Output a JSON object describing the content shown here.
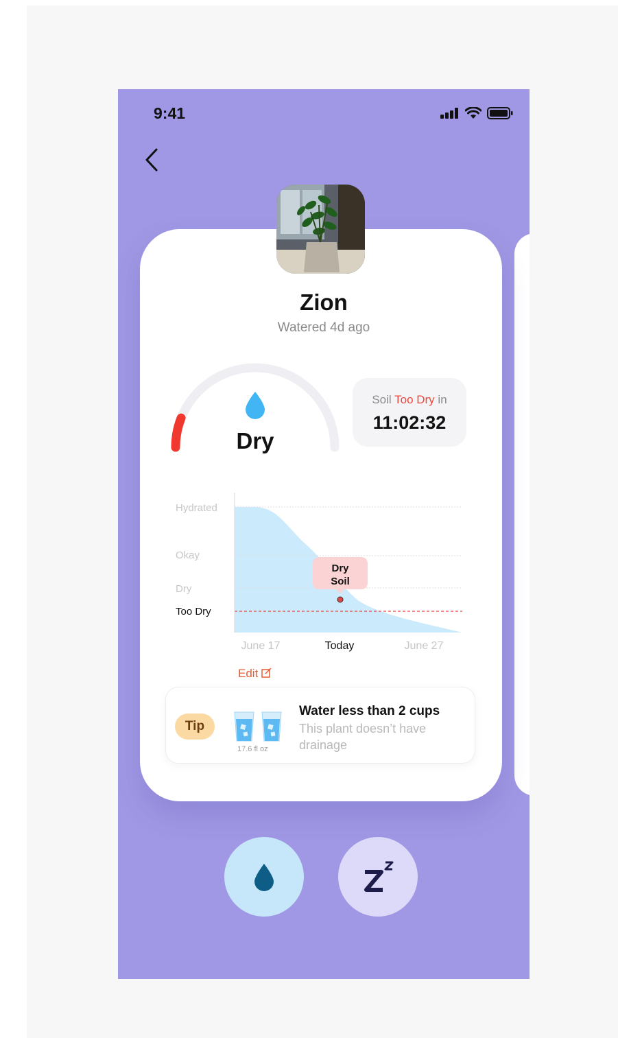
{
  "status_bar": {
    "time": "9:41"
  },
  "plant": {
    "name": "Zion",
    "watered": "Watered 4d ago"
  },
  "moisture": {
    "label": "Dry",
    "level": 0.12
  },
  "countdown": {
    "prefix": "Soil ",
    "status": "Too Dry",
    "suffix": " in",
    "timer": "11:02:32"
  },
  "chart_data": {
    "type": "area",
    "y_levels": [
      "Hydrated",
      "Okay",
      "Dry",
      "Too Dry"
    ],
    "x_ticks": [
      "June 17",
      "Today",
      "June 27"
    ],
    "threshold": "Too Dry",
    "marker": {
      "x": "Today",
      "label": [
        "Dry",
        "Soil"
      ]
    }
  },
  "edit_label": "Edit",
  "tip": {
    "badge": "Tip",
    "title": "Water less than 2 cups",
    "body": "This plant doesn’t have drainage",
    "amount": "17.6 fl oz"
  },
  "actions": {
    "water_icon": "water-drop-icon",
    "snooze_icon": "snooze-icon"
  },
  "colors": {
    "background": "#a098e4",
    "accent_red": "#ec4a3e",
    "water_blue": "#c6e6fa",
    "snooze_lilac": "#dcdaf8"
  }
}
